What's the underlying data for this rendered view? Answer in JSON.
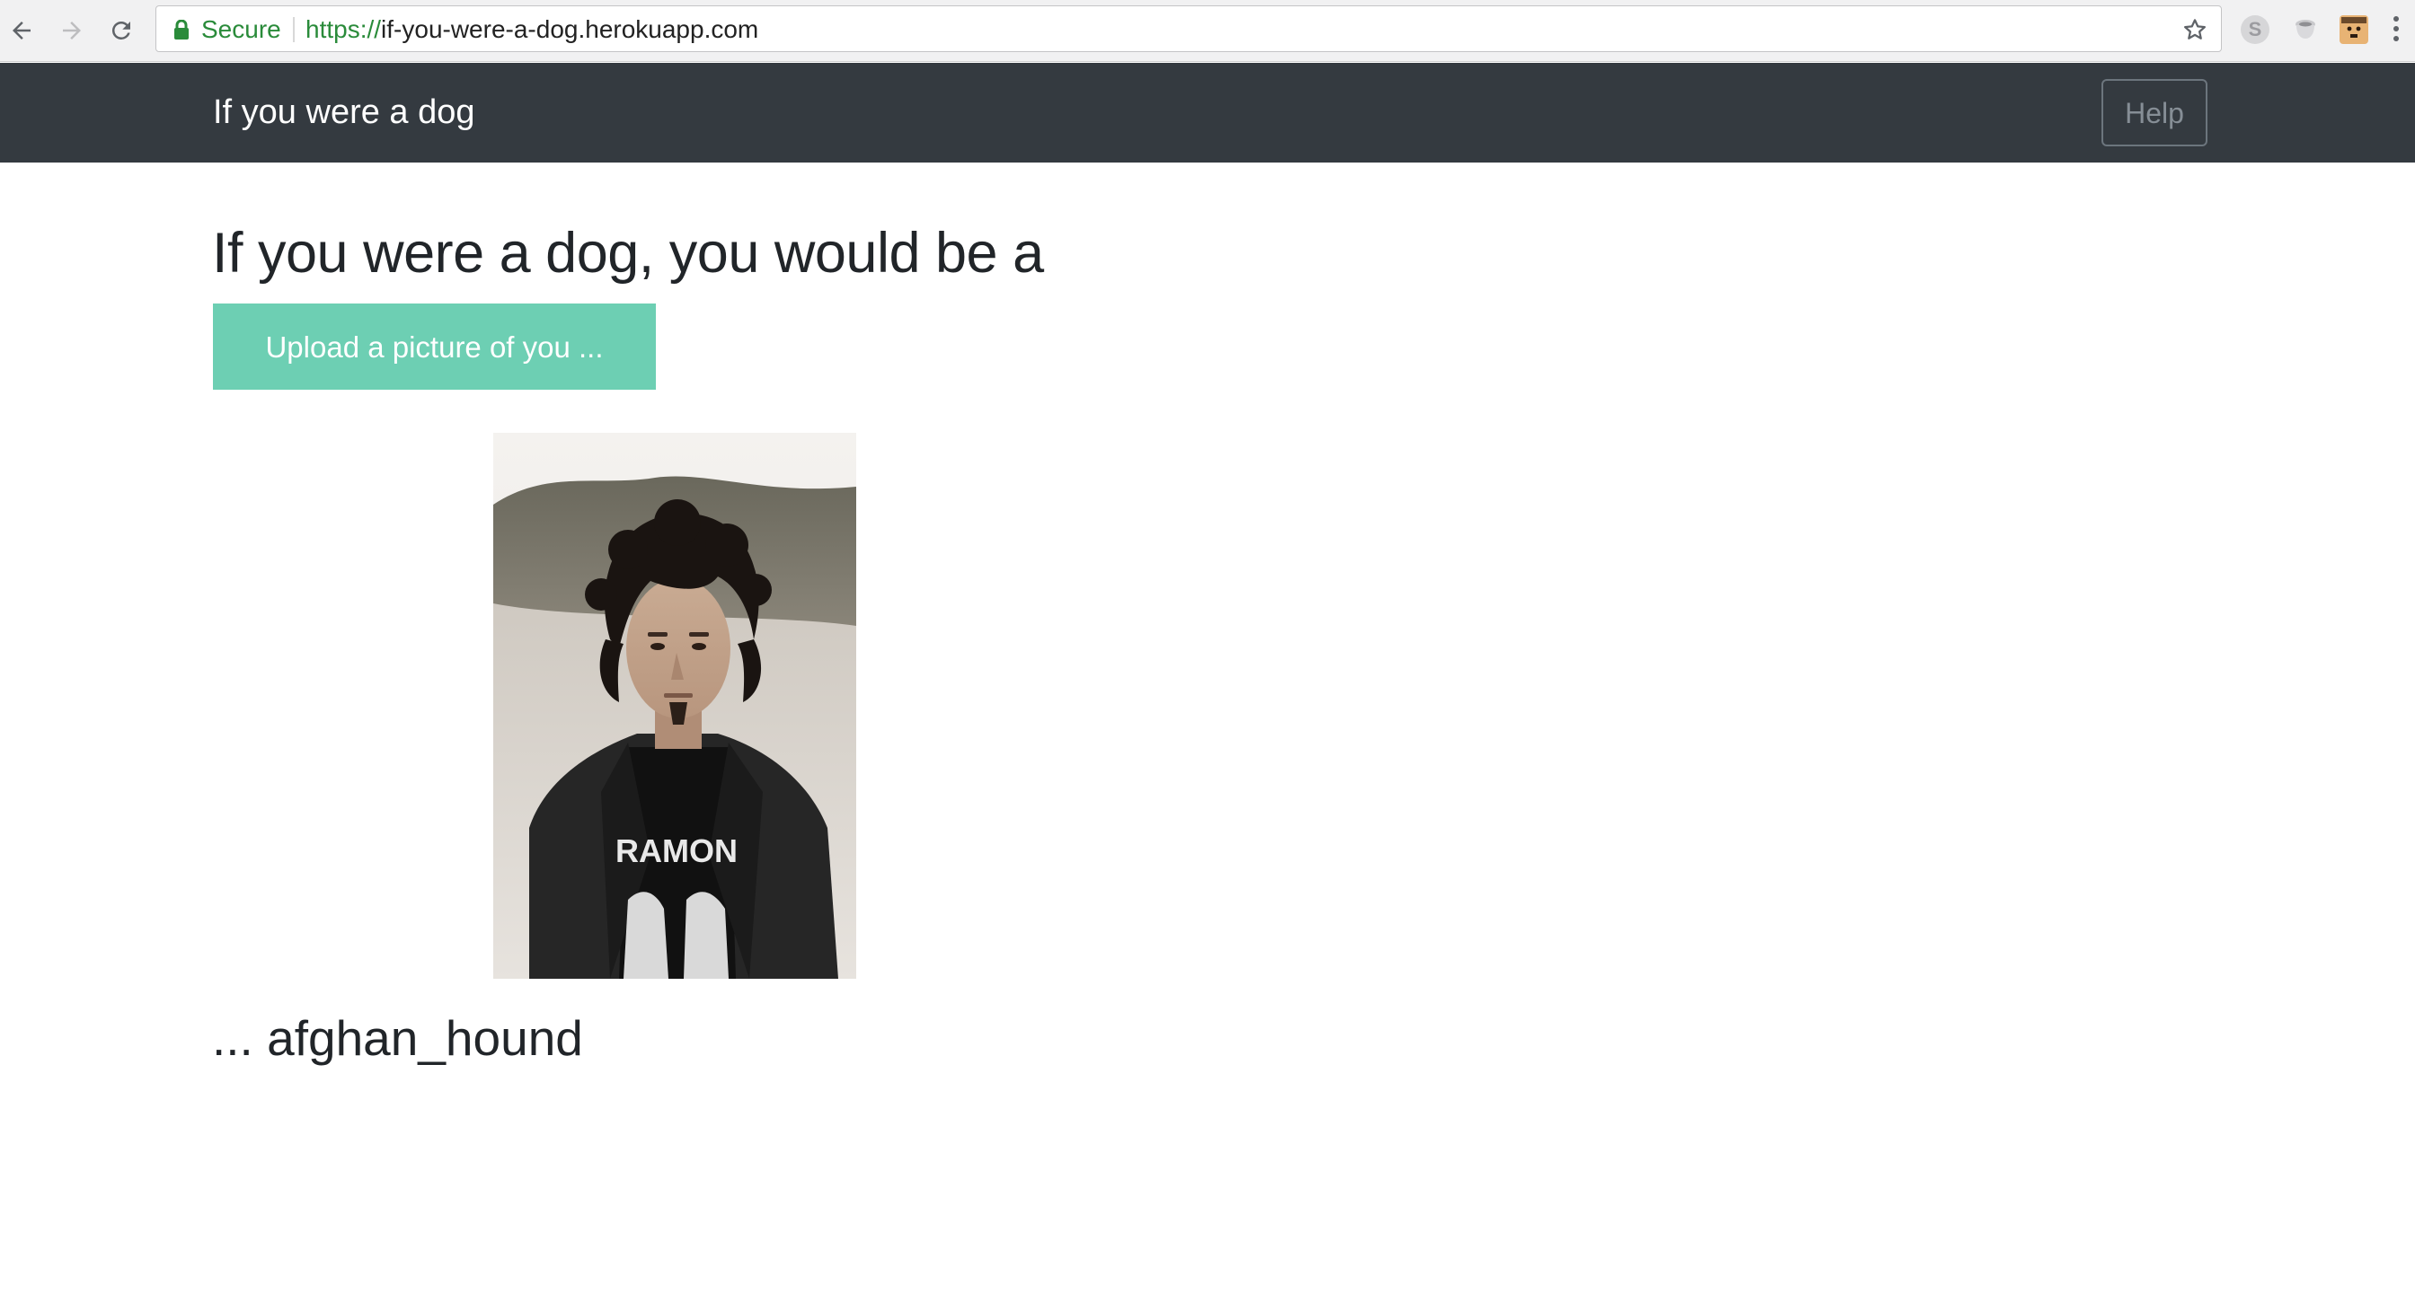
{
  "browser": {
    "secure_label": "Secure",
    "url_scheme": "https://",
    "url_host": "if-you-were-a-dog.herokuapp.com",
    "icons": {
      "back": "arrow-left-icon",
      "forward": "arrow-right-icon",
      "reload": "reload-icon",
      "lock": "lock-icon",
      "bookmark": "star-icon",
      "extensions": [
        "skype-extension-icon",
        "cup-extension-icon",
        "face-extension-icon"
      ],
      "menu": "more-vertical-icon"
    }
  },
  "navbar": {
    "brand": "If you were a dog",
    "help_label": "Help",
    "background": "#343a40"
  },
  "main": {
    "heading": "If you were a dog, you would be a",
    "upload_label": "Upload a picture of you ...",
    "upload_color": "#6dcfb3",
    "photo_shirt_text": "RAMON",
    "result": "... afghan_hound"
  }
}
